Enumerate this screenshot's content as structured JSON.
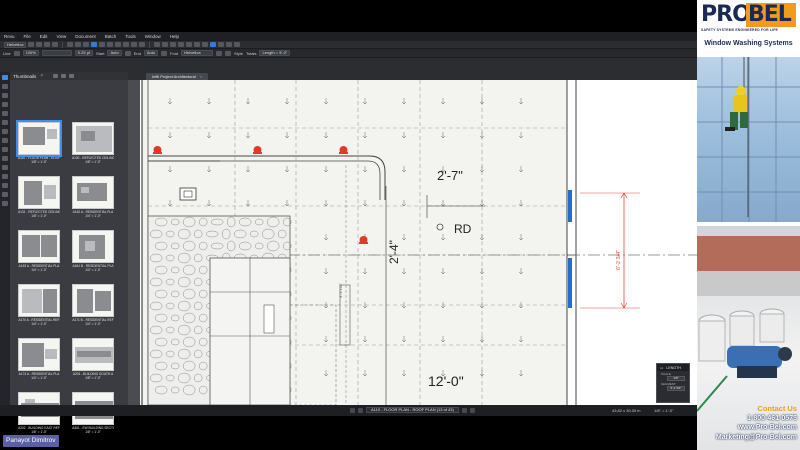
{
  "menu": [
    "Revu",
    "File",
    "Edit",
    "View",
    "Document",
    "Batch",
    "Tools",
    "Window",
    "Help"
  ],
  "properties": {
    "line_label": "Line",
    "zoom": "100%",
    "width": "0.25 pt",
    "start_label": "Start",
    "start_value": "Auto",
    "end_label": "End",
    "end_value": "Auto",
    "font_label": "Font",
    "font_value": "Helvetica",
    "style_label": "Style",
    "totals_label": "Totals",
    "totals_value": "Length = 5'-0\""
  },
  "font_box": "Helvetica",
  "thumbnails_panel": {
    "title": "Thumbnails",
    "items": [
      {
        "label": "A110 - FLOOR PLAN - ROOF",
        "scale": "1/8\" = 1'-0\""
      },
      {
        "label": "A130 - REFLECTED CEILING",
        "scale": "1/8\" = 1'-0\""
      },
      {
        "label": "A131 - REFLECTED CEILING",
        "scale": "1/8\" = 1'-0\""
      },
      {
        "label": "A162 A - RESIDENTIAL PLA",
        "scale": "1/4\" = 1'-0\""
      },
      {
        "label": "A163 A - RESIDENTIAL PLA",
        "scale": "1/4\" = 1'-0\""
      },
      {
        "label": "A164 B - RESIDENTIAL PLA",
        "scale": "1/4\" = 1'-0\""
      },
      {
        "label": "A170 A - RESIDENTIAL REF",
        "scale": "1/4\" = 1'-0\""
      },
      {
        "label": "A171 B - RESIDENTIAL REF",
        "scale": "1/4\" = 1'-0\""
      },
      {
        "label": "A174 A - RESIDENTIAL PLA",
        "scale": "1/4\" = 1'-0\""
      },
      {
        "label": "A201 - BUILDING SOUTH A",
        "scale": "1/8\" = 1'-0\""
      },
      {
        "label": "A202 - BUILDING EAST REF",
        "scale": "1/8\" = 1'-0\""
      },
      {
        "label": "A301 - EW BUILDING SECTI",
        "scale": "1/8\" = 1'-0\""
      }
    ]
  },
  "document_tab": "Infill Project Architectural",
  "drawing": {
    "dim_top": "2'-7\"",
    "dim_left": "2'-4\"",
    "drain_label": "RD",
    "dim_bottom": "12'-0\"",
    "dim_right": "6'-2 3/4\"",
    "dim_small": "4'-3 1/2\""
  },
  "measure_box": {
    "title": "LENGTH",
    "row1": "SCALE",
    "row1_value": "1/8\"",
    "row2": "SEGMENT",
    "row2_value": "6'-2 3/4\""
  },
  "status": {
    "page_label": "A110 - FLOOR PLAN - ROOF PLAN (13 of 43)",
    "dimensions": "43.82 x 30.00 in",
    "scale": "1/8\" = 1'-0\""
  },
  "ad": {
    "logo_left": "PRO",
    "logo_right": "BEL",
    "tagline": "SAFETY SYSTEMS ENGINEERED FOR LIFE",
    "title": "Window Washing Systems",
    "contact_title": "Contact Us",
    "phone": "1-800-461-0575",
    "website": "www.Pro-Bel.com",
    "email": "Marketing@Pro-Bel.com"
  },
  "presenter": "Panayot Dimitrov",
  "colors": {
    "accent_blue": "#2f7fd8",
    "dimension_red": "#e04a3c",
    "marker_blue": "#1e6fd0",
    "brand_orange": "#f29a1e",
    "brand_navy": "#1a2a55"
  }
}
